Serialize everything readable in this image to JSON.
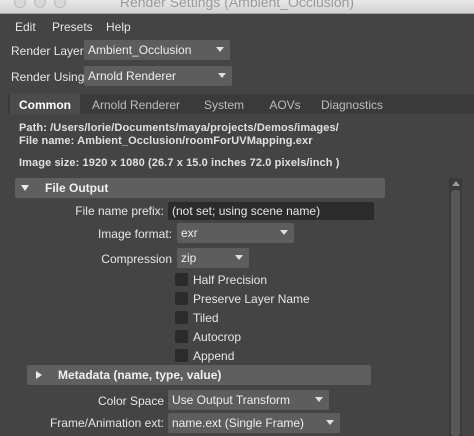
{
  "window": {
    "title": "Render Settings (Ambient_Occlusion)"
  },
  "menubar": {
    "items": [
      "Edit",
      "Presets",
      "Help"
    ]
  },
  "render_layer": {
    "label": "Render Layer",
    "value": "Ambient_Occlusion"
  },
  "render_using": {
    "label": "Render Using",
    "value": "Arnold Renderer"
  },
  "tabs": [
    {
      "label": "Common",
      "active": true
    },
    {
      "label": "Arnold Renderer",
      "active": false
    },
    {
      "label": "System",
      "active": false
    },
    {
      "label": "AOVs",
      "active": false
    },
    {
      "label": "Diagnostics",
      "active": false
    }
  ],
  "info": {
    "path": "Path: /Users/lorie/Documents/maya/projects/Demos/images/",
    "file_name": "File name:  Ambient_Occlusion/roomForUVMapping.exr",
    "image_size": "Image size: 1920 x 1080 (26.7 x 15.0 inches 72.0 pixels/inch )"
  },
  "file_output": {
    "header": "File Output",
    "prefix_label": "File name prefix:",
    "prefix_value": "(not set; using scene name)",
    "format_label": "Image format:",
    "format_value": "exr",
    "compression_label": "Compression",
    "compression_value": "zip",
    "checkboxes": [
      {
        "label": "Half Precision",
        "checked": false
      },
      {
        "label": "Preserve Layer Name",
        "checked": false
      },
      {
        "label": "Tiled",
        "checked": false
      },
      {
        "label": "Autocrop",
        "checked": false
      },
      {
        "label": "Append",
        "checked": false
      }
    ]
  },
  "metadata": {
    "header": "Metadata (name, type, value)"
  },
  "color_space": {
    "label": "Color Space",
    "value": "Use Output Transform"
  },
  "frame_ext": {
    "label": "Frame/Animation ext:",
    "value": "name.ext (Single Frame)"
  }
}
